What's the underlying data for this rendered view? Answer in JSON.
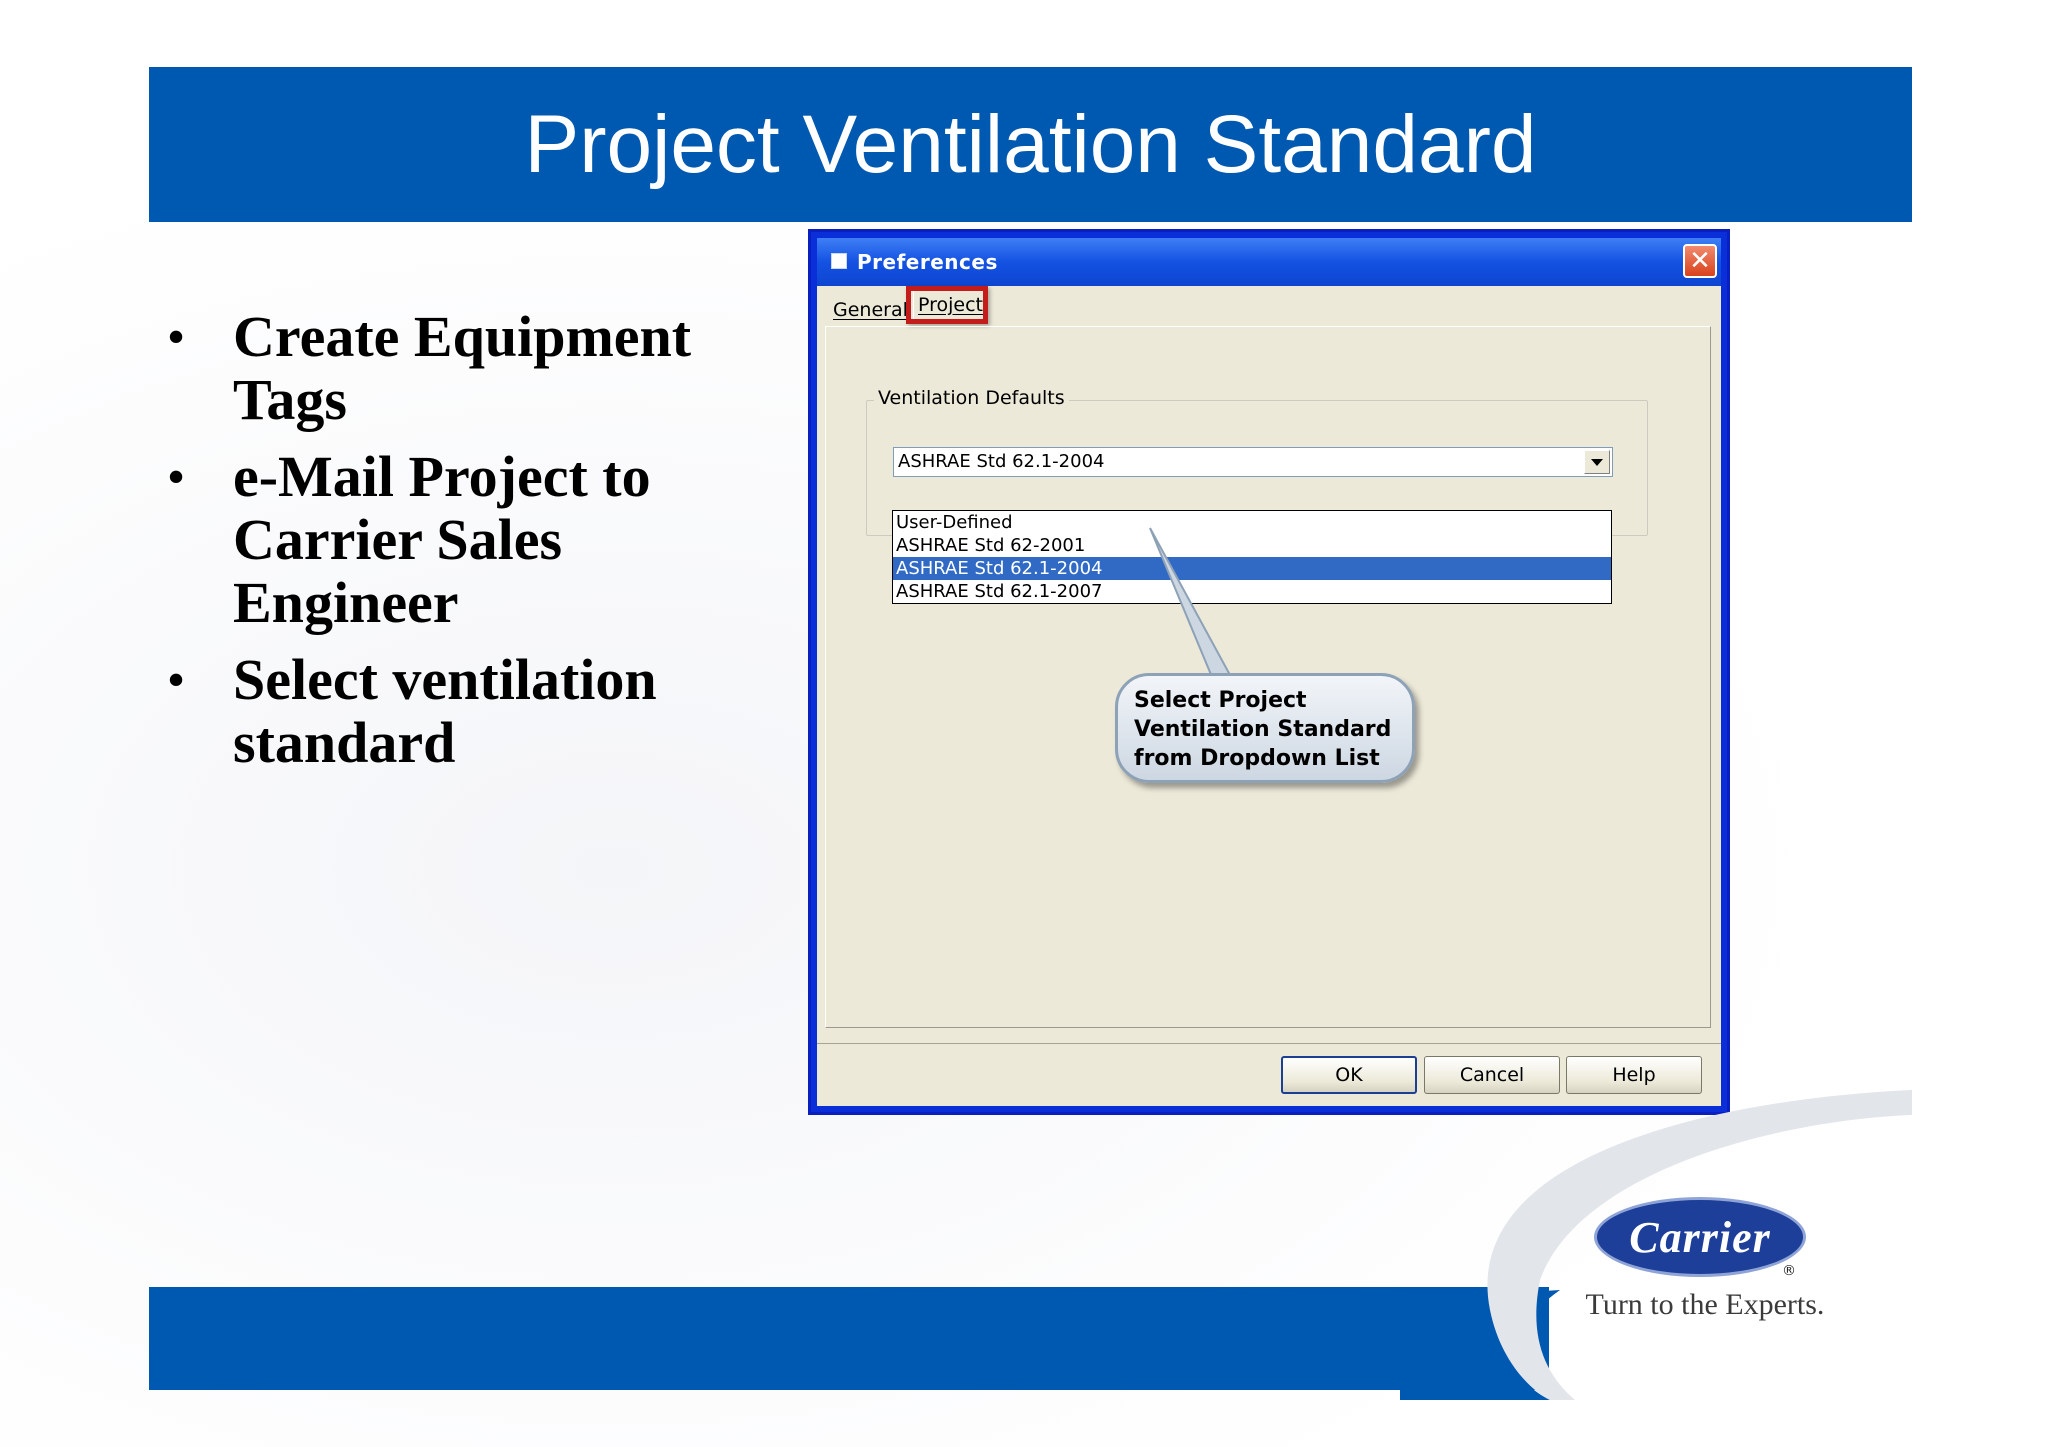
{
  "slide": {
    "title": "Project Ventilation Standard",
    "bullets": [
      "Create Equipment Tags",
      "e-Mail Project to Carrier Sales Engineer",
      "Select ventilation standard"
    ],
    "bullet_glyph": "•"
  },
  "dialog": {
    "title": "Preferences",
    "close_glyph": "✕",
    "tabs": [
      {
        "label": "General"
      },
      {
        "label": "Project"
      }
    ],
    "groupbox_label": "Ventilation Defaults",
    "select_value": "ASHRAE Std 62.1-2004",
    "options": [
      "User-Defined",
      "ASHRAE Std 62-2001",
      "ASHRAE Std 62.1-2004",
      "ASHRAE Std 62.1-2007"
    ],
    "buttons": {
      "ok": "OK",
      "cancel": "Cancel",
      "help": "Help"
    }
  },
  "callout": {
    "text": "Select Project\nVentilation Standard\nfrom Dropdown List"
  },
  "logo": {
    "name": "Carrier",
    "registered": "®",
    "tagline": "Turn to the Experts."
  },
  "colors": {
    "brand_blue": "#0059b0",
    "highlight_red": "#c41b1b",
    "selection_blue": "#316ac5"
  }
}
